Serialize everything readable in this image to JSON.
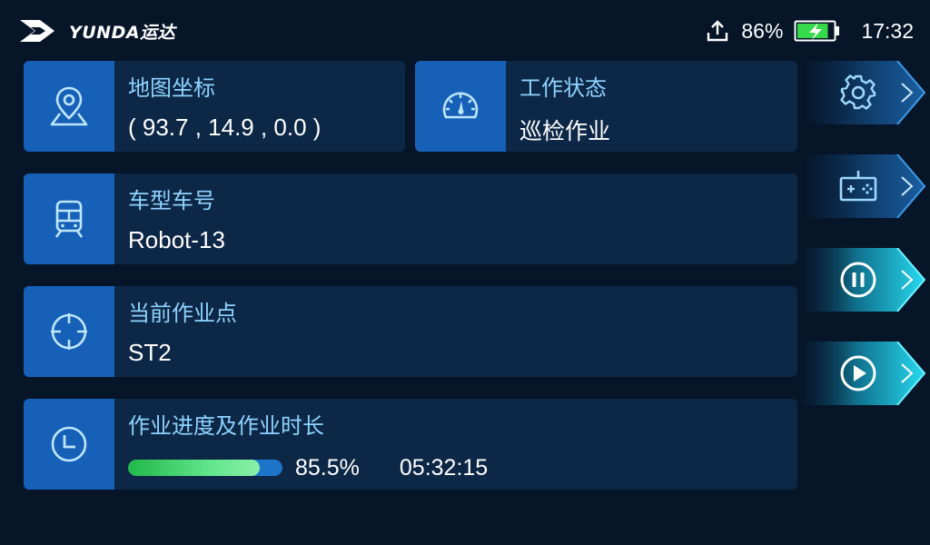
{
  "brand": {
    "name": "YUNDA运达"
  },
  "status": {
    "battery_percent": "86%",
    "battery_level": 0.86,
    "time": "17:32"
  },
  "cards": {
    "coordinates": {
      "label": "地图坐标",
      "value": "( 93.7 , 14.9 , 0.0 )",
      "icon": "map-pin-icon"
    },
    "work_status": {
      "label": "工作状态",
      "value": "巡检作业",
      "icon": "gauge-icon"
    },
    "vehicle": {
      "label": "车型车号",
      "value": "Robot-13",
      "icon": "train-icon"
    },
    "current_point": {
      "label": "当前作业点",
      "value": "ST2",
      "icon": "crosshair-icon"
    },
    "progress": {
      "label": "作业进度及作业时长",
      "percent_text": "85.5%",
      "fraction": 0.855,
      "elapsed": "05:32:15",
      "icon": "clock-icon"
    }
  },
  "side_buttons": [
    {
      "name": "settings",
      "icon": "gear-icon",
      "active": false
    },
    {
      "name": "gamepad",
      "icon": "gamepad-icon",
      "active": false
    },
    {
      "name": "pause",
      "icon": "pause-icon",
      "active": true
    },
    {
      "name": "play",
      "icon": "play-icon",
      "active": true
    }
  ],
  "colors": {
    "background": "#071528",
    "card": "#0d2746",
    "icon_panel": "#1660b8",
    "label": "#8ed3ff",
    "progress_fill": "#4fd873",
    "progress_track": "#1c75c9",
    "battery": "#35d94a",
    "active_glow": "#1fd6ee"
  }
}
